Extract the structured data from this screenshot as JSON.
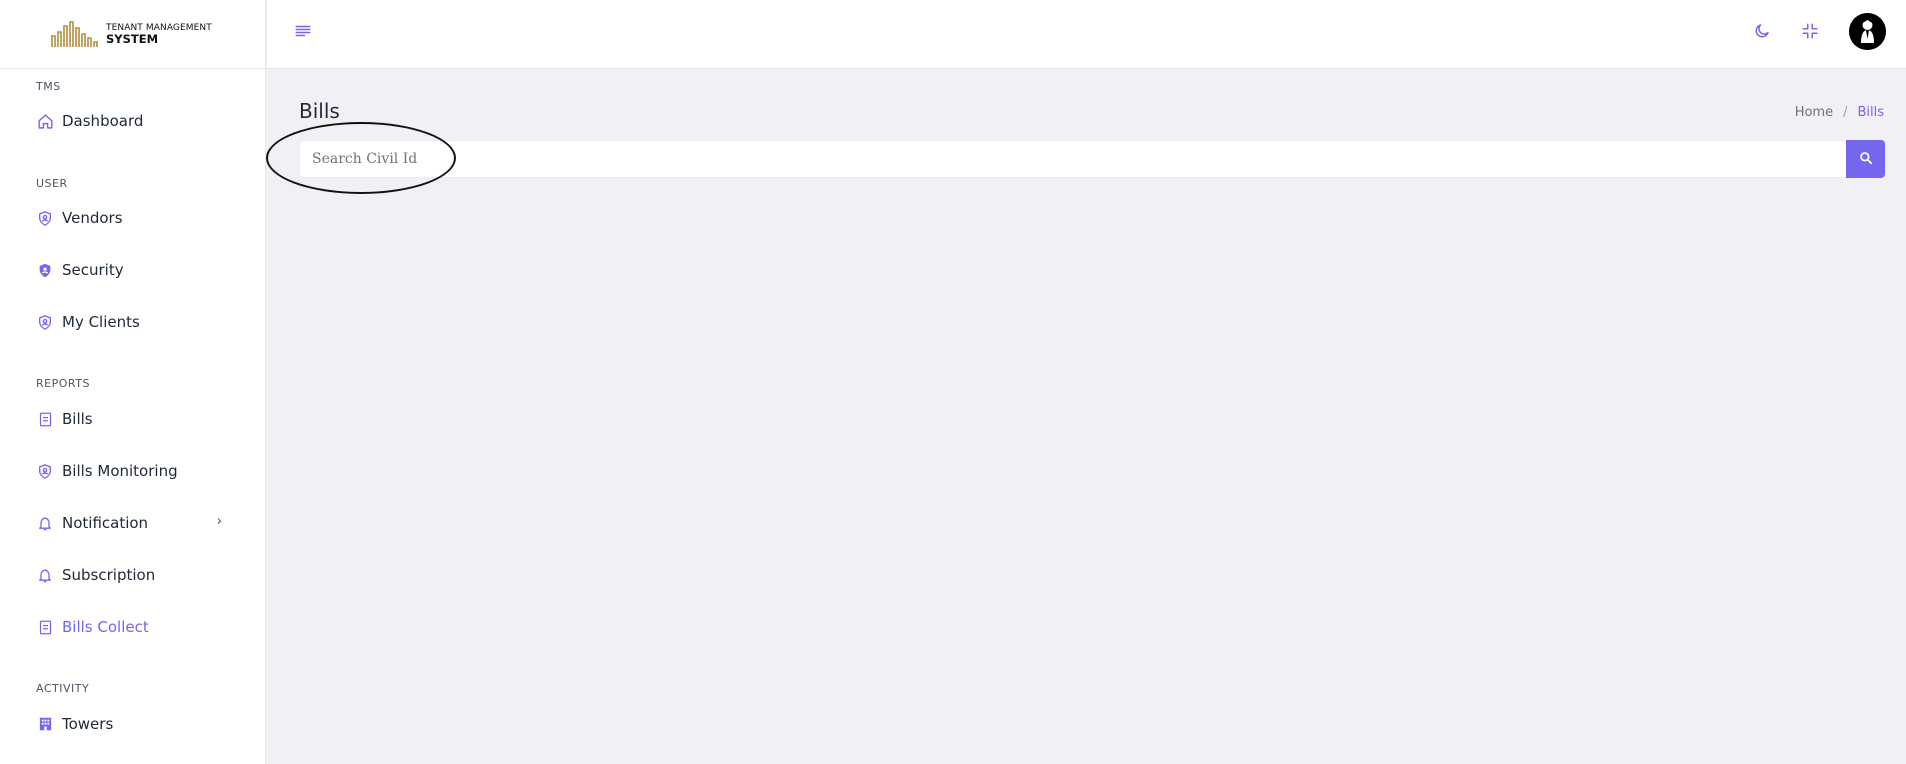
{
  "brand": {
    "line1": "TENANT MANAGEMENT",
    "line2": "SYSTEM",
    "logo_color": "#b08d3f"
  },
  "sidebar": {
    "sections": [
      {
        "label": "TMS"
      },
      {
        "label": "USER"
      },
      {
        "label": "REPORTS"
      },
      {
        "label": "ACTIVITY"
      }
    ],
    "items": [
      {
        "label": "Dashboard",
        "icon": "home-icon"
      },
      {
        "label": "Vendors",
        "icon": "shield-user-icon"
      },
      {
        "label": "Security",
        "icon": "shield-filled-icon"
      },
      {
        "label": "My Clients",
        "icon": "shield-user-icon"
      },
      {
        "label": "Bills",
        "icon": "document-icon"
      },
      {
        "label": "Bills Monitoring",
        "icon": "shield-user-icon"
      },
      {
        "label": "Notification",
        "icon": "bell-icon",
        "has_submenu": true
      },
      {
        "label": "Subscription",
        "icon": "bell-icon"
      },
      {
        "label": "Bills Collect",
        "icon": "document-icon",
        "active": true
      },
      {
        "label": "Towers",
        "icon": "building-icon"
      }
    ]
  },
  "topbar": {
    "icons": [
      "menu-icon",
      "moon-icon",
      "minimize-icon",
      "avatar"
    ]
  },
  "main": {
    "title": "Bills",
    "breadcrumb": {
      "home": "Home",
      "separator": "/",
      "current": "Bills"
    },
    "search": {
      "placeholder": "Search Civil Id",
      "value": ""
    }
  },
  "colors": {
    "accent": "#7367f0",
    "background": "#f0f0f5",
    "text": "#1f2937"
  }
}
